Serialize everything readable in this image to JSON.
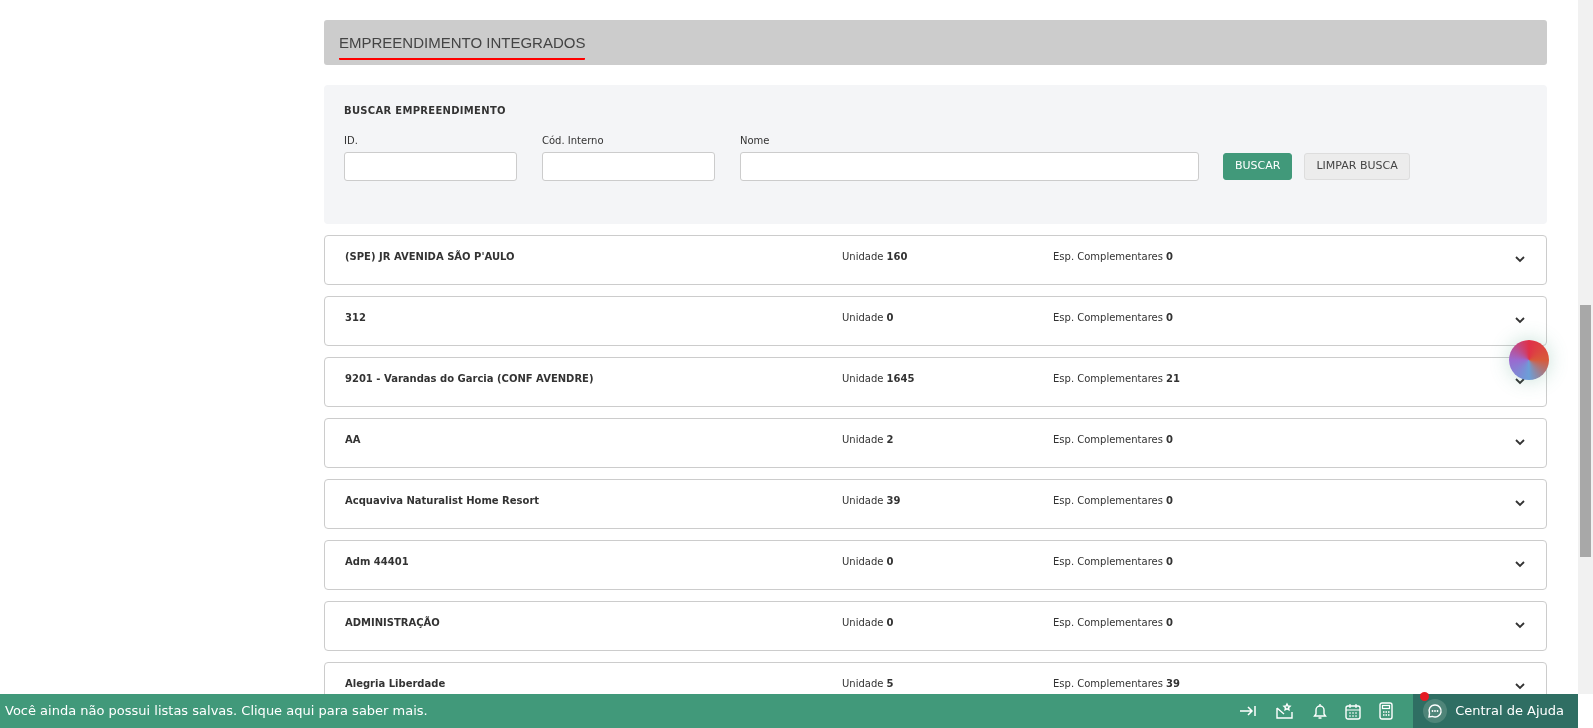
{
  "header": {
    "title": "EMPREENDIMENTO INTEGRADOS"
  },
  "search": {
    "title": "BUSCAR EMPREENDIMENTO",
    "fields": [
      {
        "label": "ID.",
        "kind": "small"
      },
      {
        "label": "Cód. Interno",
        "kind": "small"
      },
      {
        "label": "Nome",
        "kind": "wide"
      }
    ],
    "buttons": [
      {
        "label": "BUSCAR",
        "kind": "primary"
      },
      {
        "label": "LIMPAR BUSCA",
        "kind": "secondary"
      }
    ]
  },
  "rows": [
    {
      "name": "(SPE) JR AVENIDA SÃO P'AULO",
      "units_label": "Unidade",
      "units": "160",
      "extras_label": "Esp. Complementares",
      "extras": "0"
    },
    {
      "name": "312",
      "units_label": "Unidade",
      "units": "0",
      "extras_label": "Esp. Complementares",
      "extras": "0"
    },
    {
      "name": "9201 - Varandas do Garcia (CONF AVENDRE)",
      "units_label": "Unidade",
      "units": "1645",
      "extras_label": "Esp. Complementares",
      "extras": "21"
    },
    {
      "name": "AA",
      "units_label": "Unidade",
      "units": "2",
      "extras_label": "Esp. Complementares",
      "extras": "0"
    },
    {
      "name": "Acquaviva Naturalist Home Resort",
      "units_label": "Unidade",
      "units": "39",
      "extras_label": "Esp. Complementares",
      "extras": "0"
    },
    {
      "name": "Adm 44401",
      "units_label": "Unidade",
      "units": "0",
      "extras_label": "Esp. Complementares",
      "extras": "0"
    },
    {
      "name": "ADMINISTRAÇÃO",
      "units_label": "Unidade",
      "units": "0",
      "extras_label": "Esp. Complementares",
      "extras": "0"
    },
    {
      "name": "Alegria Liberdade",
      "units_label": "Unidade",
      "units": "5",
      "extras_label": "Esp. Complementares",
      "extras": "39"
    }
  ],
  "footer": {
    "message": "Você ainda não possui listas salvas. Clique aqui para saber mais.",
    "help_label": "Central de Ajuda",
    "help_notification": true
  }
}
